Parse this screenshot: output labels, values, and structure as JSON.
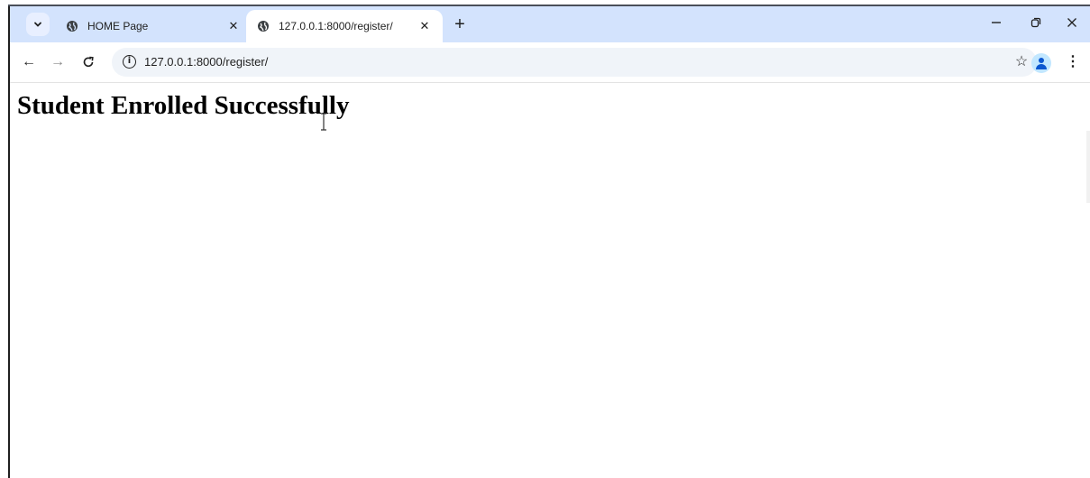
{
  "tabs": [
    {
      "title": "HOME Page",
      "active": false
    },
    {
      "title": "127.0.0.1:8000/register/",
      "active": true
    }
  ],
  "icons": {
    "tab_search": "chevron-down-icon",
    "favicon": "globe-icon",
    "close": "close-icon",
    "new_tab": "plus-icon",
    "minimize": "minimize-icon",
    "restore": "restore-icon",
    "window_close": "window-close-icon",
    "back": "arrow-left-icon",
    "forward": "arrow-right-icon",
    "reload": "reload-icon",
    "site_info": "info-icon",
    "bookmark": "star-icon",
    "profile": "profile-icon",
    "menu": "kebab-menu-icon"
  },
  "toolbar": {
    "url": "127.0.0.1:8000/register/"
  },
  "page": {
    "heading": "Student Enrolled Successfully"
  },
  "colors": {
    "tabstrip": "#d3e3fd",
    "omnibox": "#f0f4f9",
    "accent": "#0b57d0"
  }
}
